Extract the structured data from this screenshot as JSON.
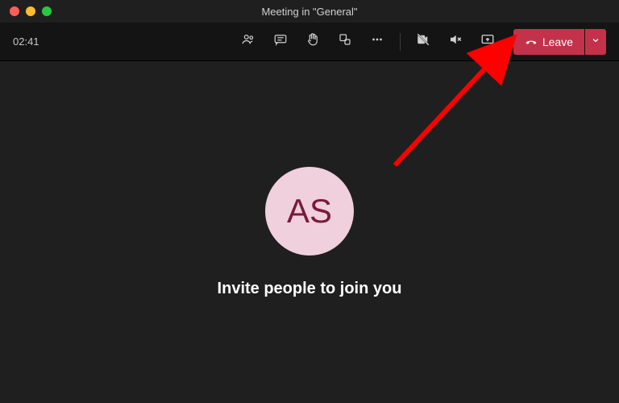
{
  "window": {
    "title": "Meeting in \"General\""
  },
  "toolbar": {
    "timer": "02:41",
    "leave_label": "Leave"
  },
  "stage": {
    "avatar_initials": "AS",
    "invite_text": "Invite people to join you"
  },
  "colors": {
    "leave_bg": "#c4314b",
    "avatar_bg": "#f0d0dc",
    "avatar_fg": "#7a1a3a",
    "arrow": "#ff0000"
  }
}
